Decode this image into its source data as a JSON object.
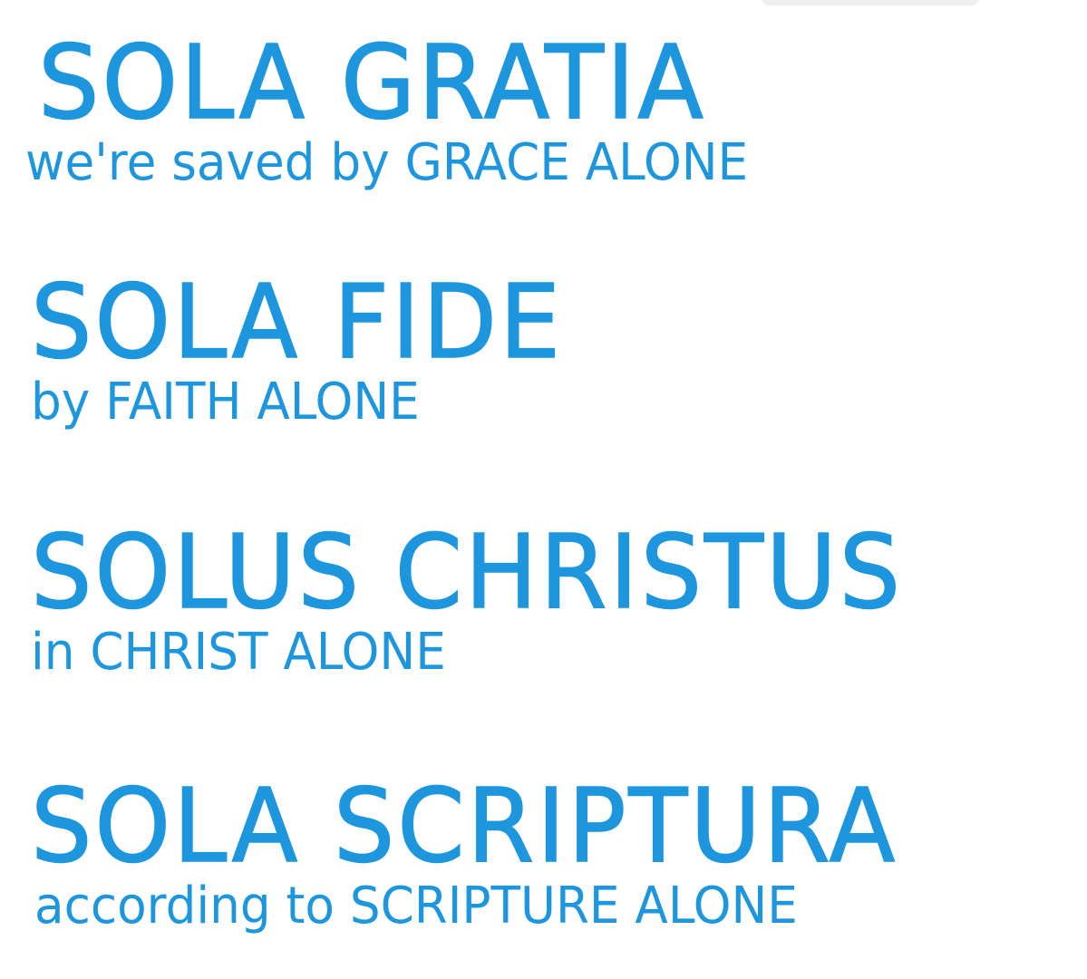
{
  "colors": {
    "text": "#1e96de",
    "background": "#ffffff"
  },
  "solas": [
    {
      "heading": "SOLA GRATIA",
      "subtitle": "we're saved by GRACE ALONE"
    },
    {
      "heading": "SOLA FIDE",
      "subtitle": "by FAITH ALONE"
    },
    {
      "heading": "SOLUS CHRISTUS",
      "subtitle": "in CHRIST ALONE"
    },
    {
      "heading": "SOLA SCRIPTURA",
      "subtitle": "according to SCRIPTURE ALONE"
    }
  ]
}
